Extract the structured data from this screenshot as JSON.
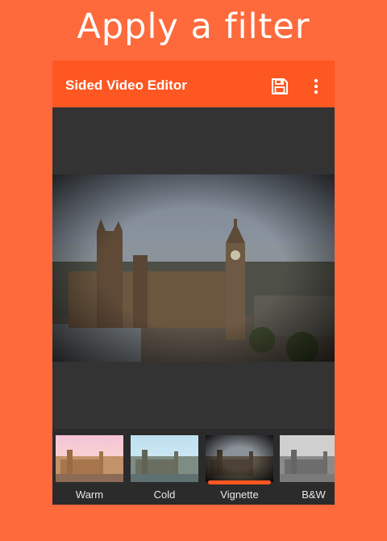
{
  "headline": "Apply a filter",
  "app_bar": {
    "title": "Sided Video Editor",
    "save_icon": "save-icon",
    "menu_icon": "more-vert-icon"
  },
  "filters": [
    {
      "label": "Warm",
      "selected": false
    },
    {
      "label": "Cold",
      "selected": false
    },
    {
      "label": "Vignette",
      "selected": true
    },
    {
      "label": "B&W",
      "selected": false
    }
  ],
  "colors": {
    "background": "#ff6a3d",
    "app_bar": "#ff5722",
    "accent": "#ff5722",
    "canvas": "#333333"
  }
}
